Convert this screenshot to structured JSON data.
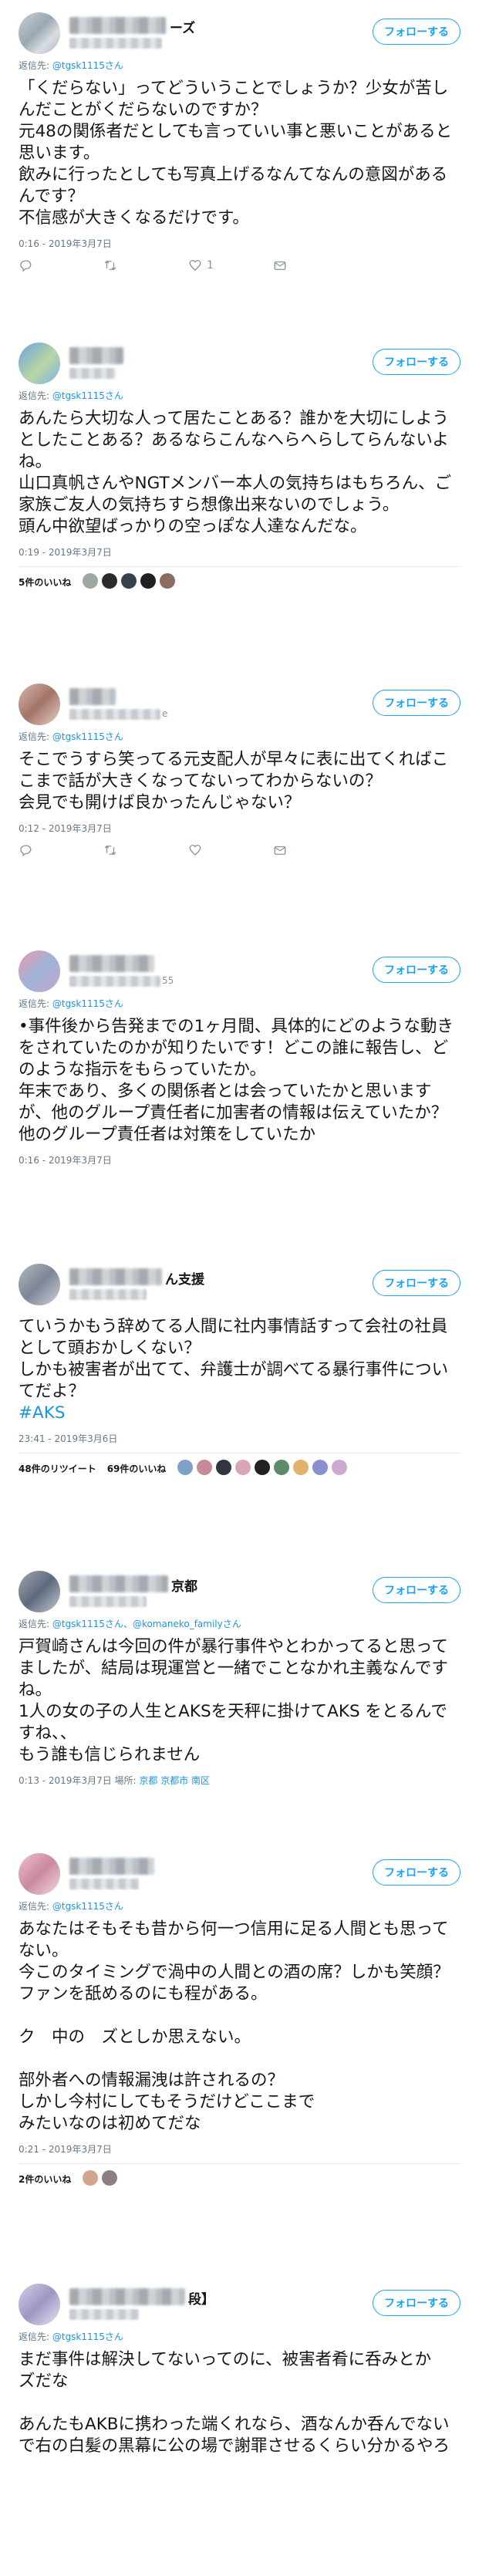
{
  "follow_label": "フォローする",
  "tweets": [
    {
      "name_suffix": "ーズ",
      "handle_suffix": "",
      "reply_label": "返信先: ",
      "reply_handle": "@tgsk1115さん",
      "text": "「くだらない」ってどういうことでしょうか？少女が苦しんだことがくだらないのですか？\n元48の関係者だとしても言っていい事と悪いことがあると思います。\n飲みに行ったとしても写真上げるなんてなんの意図があるんです？\n不信感が大きくなるだけです。",
      "meta": "0:16 - 2019年3月7日",
      "like_count": "1"
    },
    {
      "name_suffix": "",
      "handle_suffix": "",
      "reply_label": "返信先: ",
      "reply_handle": "@tgsk1115さん",
      "text": "あんたら大切な人って居たことある？誰かを大切にしようとしたことある？あるならこんなへらへらしてらんないよね。\n山口真帆さんやNGTメンバー本人の気持ちはもちろん、ご家族ご友人の気持ちすら想像出来ないのでしょう。\n頭ん中欲望ばっかりの空っぽな人達なんだな。",
      "meta": "0:19 - 2019年3月7日",
      "likes_count": "5件のいいね"
    },
    {
      "name_suffix": "",
      "handle_suffix": "e",
      "reply_label": "返信先: ",
      "reply_handle": "@tgsk1115さん",
      "text": "そこでうすら笑ってる元支配人が早々に表に出てくればここまで話が大きくなってないってわからないの？\n会見でも開けば良かったんじゃない？",
      "meta": "0:12 - 2019年3月7日"
    },
    {
      "name_suffix": "",
      "handle_suffix": "55",
      "reply_label": "返信先: ",
      "reply_handle": "@tgsk1115さん",
      "text": "•事件後から告発までの1ヶ月間、具体的にどのような動きをされていたのかが知りたいです！どこの誰に報告し、どのような指示をもらっていたか。\n年末であり、多くの関係者とは会っていたかと思いますが、他のグループ責任者に加害者の情報は伝えていたか？\n他のグループ責任者は対策をしていたか",
      "meta": "0:16 - 2019年3月7日"
    },
    {
      "name_suffix": "ん支援",
      "handle_suffix": "",
      "text": "ていうかもう辞めてる人間に社内事情話すって会社の社員として頭おかしくない？\nしかも被害者が出てて、弁護士が調べてる暴行事件についてだよ？",
      "hashtag": "#AKS",
      "meta": "23:41 - 2019年3月6日",
      "retweets_count": "48件のリツイート",
      "likes_count": "69件のいいね"
    },
    {
      "name_suffix": "京都",
      "handle_suffix": "",
      "reply_label": "返信先: ",
      "reply_handle": "@tgsk1115さん、",
      "reply_handle2": "@komaneko_familyさん",
      "text": "戸賀崎さんは今回の件が暴行事件やとわかってると思ってましたが、結局は現運営と一緒でことなかれ主義なんですね。\n1人の女の子の人生とAKSを天秤に掛けてAKS をとるんですね、、\nもう誰も信じられません",
      "meta_prefix": "0:13 - 2019年3月7日 場所: ",
      "meta_location": "京都 京都市 南区"
    },
    {
      "name_suffix": "",
      "handle_suffix": "",
      "reply_label": "返信先: ",
      "reply_handle": "@tgsk1115さん",
      "text": "あなたはそもそも昔から何一つ信用に足る人間とも思ってない。\n今このタイミングで渦中の人間との酒の席？しかも笑顔？\nファンを舐めるのにも程がある。\n\nク　中の　ズとしか思えない。\n\n部外者への情報漏洩は許されるの？\nしかし今村にしてもそうだけどここまで\nみたいなのは初めてだな",
      "meta": "0:21 - 2019年3月7日",
      "likes_count": "2件のいいね"
    },
    {
      "name_suffix": "段】",
      "handle_suffix": "",
      "reply_label": "返信先: ",
      "reply_handle": "@tgsk1115さん",
      "text": "まだ事件は解決してないってのに、被害者肴に呑みとか　ズだな\n\nあんたもAKBに携わった端くれなら、酒なんか呑んでないで右の白髪の黒幕に公の場で謝罪させるくらい分かるやろ"
    }
  ]
}
